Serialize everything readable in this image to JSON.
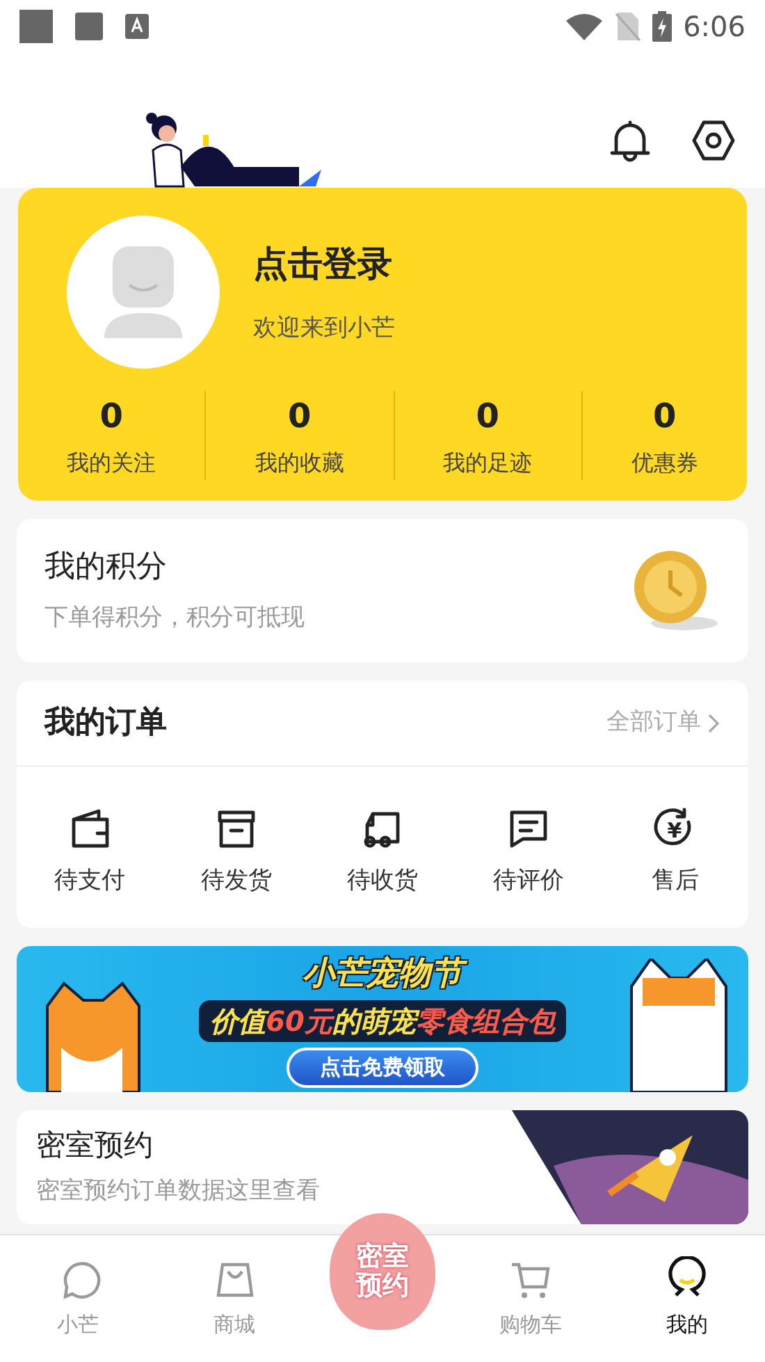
{
  "status_bar": {
    "time": "6:06"
  },
  "profile": {
    "title": "点击登录",
    "subtitle": "欢迎来到小芒",
    "stats": [
      {
        "value": "0",
        "label": "我的关注"
      },
      {
        "value": "0",
        "label": "我的收藏"
      },
      {
        "value": "0",
        "label": "我的足迹"
      },
      {
        "value": "0",
        "label": "优惠券"
      }
    ]
  },
  "points": {
    "title": "我的积分",
    "subtitle": "下单得积分，积分可抵现"
  },
  "orders": {
    "title": "我的订单",
    "link": "全部订单",
    "items": [
      {
        "kind": "wallet",
        "label": "待支付"
      },
      {
        "kind": "box",
        "label": "待发货"
      },
      {
        "kind": "truck",
        "label": "待收货"
      },
      {
        "kind": "comment",
        "label": "待评价"
      },
      {
        "kind": "refund",
        "label": "售后",
        "icon_text": "¥"
      }
    ]
  },
  "banner": {
    "title": "小芒宠物节",
    "subtitle_parts": [
      {
        "text": "价值",
        "color": "#ffe14d"
      },
      {
        "text": "60元",
        "color": "#ff5a4a"
      },
      {
        "text": "的萌宠",
        "color": "#ffe14d"
      },
      {
        "text": "零食组合包",
        "color": "#ff5a4a"
      }
    ],
    "button": "点击免费领取"
  },
  "escape_room": {
    "title": "密室预约",
    "subtitle": "密室预约订单数据这里查看"
  },
  "tab_bar": [
    {
      "kind": "circle",
      "label": "小芒",
      "selected": false
    },
    {
      "kind": "bag",
      "label": "商城",
      "selected": false
    },
    {
      "kind": "peach",
      "label": "密室预约",
      "selected": false
    },
    {
      "kind": "cart",
      "label": "购物车",
      "selected": false
    },
    {
      "kind": "face",
      "label": "我的",
      "selected": true
    }
  ]
}
